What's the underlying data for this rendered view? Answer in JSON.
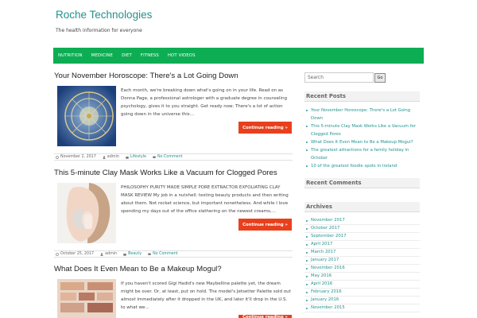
{
  "site": {
    "title": "Roche Technologies",
    "tagline": "The health information for everyone"
  },
  "nav": {
    "items": [
      "NUTRITION",
      "MEDICINE",
      "DIET",
      "FITNESS",
      "HOT VIDEOS"
    ]
  },
  "posts": [
    {
      "title": "Your November Horoscope: There's a Lot Going Down",
      "excerpt": "Each month, we're breaking down what's going on in your life. Read on as Donna Page, a professional astrologer with a graduate degree in counseling psychology, gives it to you straight. Get ready now: There's a lot of action going down in the universe this…",
      "more": "Continue reading »",
      "date": "November 2, 2017",
      "author": "admin",
      "category": "Lifestyle",
      "comments": "No Comment"
    },
    {
      "title": "This 5-minute Clay Mask Works Like a Vacuum for Clogged Pores",
      "excerpt": "PHILOSOPHY PURITY MADE SIMPLE PORE EXTRACTOR EXFOLIATING CLAY MASK REVIEW My job in a nutshell: testing beauty products and then writing about them. Not rocket science, but important nonetheless. And while I love spending my days out of the office slathering on the newest creams,…",
      "more": "Continue reading »",
      "date": "October 25, 2017",
      "author": "admin",
      "category": "Beauty",
      "comments": "No Comment"
    },
    {
      "title": "What Does It Even Mean to Be a Makeup Mogul?",
      "excerpt": "If you haven't scored Gigi Hadid's new Maybelline palette yet, the dream might be over. Or, at least, put on hold. The model's Jetsetter Palette sold out almost immediately after it dropped in the UK, and later it'll drop in the U.S. to what we…",
      "more": "Continue reading »"
    }
  ],
  "sidebar": {
    "search_placeholder": "Search",
    "search_button": "Go",
    "recent_posts_title": "Recent Posts",
    "recent_posts": [
      "Your November Horoscope: There's a Lot Going Down",
      "This 5-minute Clay Mask Works Like a Vacuum for Clogged Pores",
      "What Does It Even Mean to Be a Makeup Mogul?",
      "The greatest attractions for a family holiday in October",
      "10 of the greatest foodie spots in Ireland"
    ],
    "recent_comments_title": "Recent Comments",
    "archives_title": "Archives",
    "archives": [
      "November 2017",
      "October 2017",
      "September 2017",
      "April 2017",
      "March 2017",
      "January 2017",
      "November 2016",
      "May 2016",
      "April 2016",
      "February 2016",
      "January 2016",
      "November 2015"
    ]
  },
  "colors": {
    "nav_bg": "#0dad53",
    "accent": "#23918f",
    "button": "#e8401c"
  }
}
